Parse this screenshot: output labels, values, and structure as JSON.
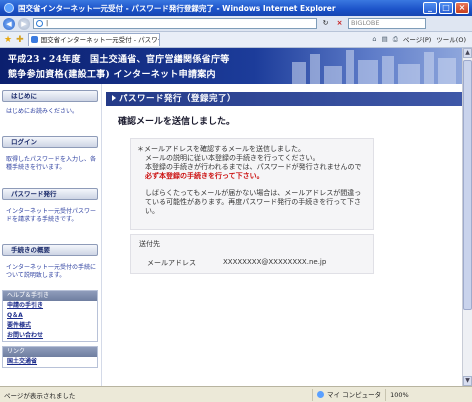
{
  "window": {
    "title": "国交省インターネット一元受付 - パスワード発行登録完了 - Windows Internet Explorer",
    "minimize": "_",
    "maximize": "□",
    "close": "×"
  },
  "addressbar": {
    "back": "◀",
    "forward": "▶",
    "refresh": "↻",
    "stop": "×",
    "search_placeholder": "BIGLOBE"
  },
  "tabs": {
    "active_tab": "国交省インターネット一元受付 - パスワード発行登…",
    "tools": [
      "ページ(P)",
      "ツール(O)"
    ]
  },
  "banner": {
    "line1": "平成23・24年度　国土交通省、官庁営繕関係省庁等",
    "line2": "競争参加資格(建設工事) インターネット申請案内"
  },
  "sidebar": {
    "sections": [
      {
        "head": "はじめに",
        "body": "はじめにお読みください。"
      },
      {
        "head": "ログイン",
        "body": "取得したパスワードを入力し、各種手続きを行います。"
      },
      {
        "head": "パスワード発行",
        "body": "インターネット一元受付パスワードを請求する手続きです。"
      },
      {
        "head": "手続きの概要",
        "body": "インターネット一元受付の手続について説明致します。"
      }
    ],
    "help": {
      "head": "ヘルプ＆手引き",
      "items": [
        "申請の手引き",
        "Q＆A",
        "要件様式",
        "お問い合わせ"
      ]
    },
    "links": {
      "head": "リンク",
      "items": [
        "国土交通省"
      ]
    }
  },
  "main": {
    "heading": "パスワード発行（登録完了）",
    "message": "確認メールを送信しました。",
    "note": {
      "l1": "＊メールアドレスを確認するメールを送信しました。",
      "l2": "メールの説明に従い本登録の手続きを行ってください。",
      "l3": "本登録の手続きが行われるまでは、パスワードが発行されませんので",
      "l4": "必ず本登録の手続きを行って下さい。",
      "l5": "しばらくたってもメールが届かない場合は、メールアドレスが間違っている可能性があります。再度パスワード発行の手続きを行って下さい。"
    },
    "destination": {
      "head": "送付先",
      "key": "メールアドレス",
      "value": "XXXXXXXX@XXXXXXXX.ne.jp"
    }
  },
  "statusbar": {
    "text": "ページが表示されました",
    "zone": "マイ コンピュータ",
    "zoom": "100%"
  }
}
